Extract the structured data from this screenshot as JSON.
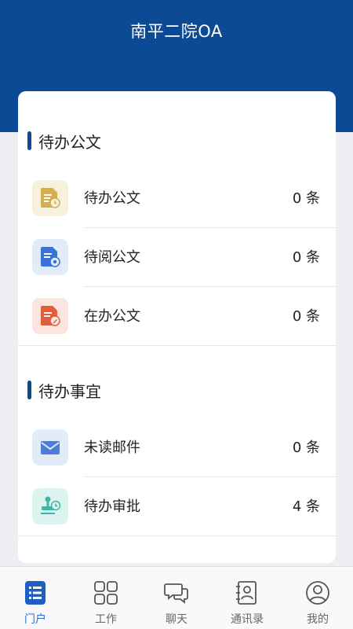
{
  "header": {
    "title": "南平二院OA"
  },
  "sections": [
    {
      "title": "待办公文",
      "items": [
        {
          "label": "待办公文",
          "count": "0 条",
          "icon": "doc-clock-icon",
          "color": "#d3b04d",
          "bg": "#f6f0dc"
        },
        {
          "label": "待阅公文",
          "count": "0 条",
          "icon": "doc-eye-icon",
          "color": "#3a73d6",
          "bg": "#e2ebf8"
        },
        {
          "label": "在办公文",
          "count": "0 条",
          "icon": "doc-edit-icon",
          "color": "#e05e3a",
          "bg": "#fbe6df"
        }
      ]
    },
    {
      "title": "待办事宜",
      "items": [
        {
          "label": "未读邮件",
          "count": "0 条",
          "icon": "mail-icon",
          "color": "#4a7ddc",
          "bg": "#e2ebf8"
        },
        {
          "label": "待办审批",
          "count": "4 条",
          "icon": "stamp-icon",
          "color": "#3db6a6",
          "bg": "#dcf3ef"
        }
      ]
    }
  ],
  "tabbar": {
    "tabs": [
      {
        "label": "门户",
        "icon": "list-icon",
        "active": true
      },
      {
        "label": "工作",
        "icon": "grid-icon",
        "active": false
      },
      {
        "label": "聊天",
        "icon": "chat-icon",
        "active": false
      },
      {
        "label": "通讯录",
        "icon": "contacts-icon",
        "active": false
      },
      {
        "label": "我的",
        "icon": "profile-icon",
        "active": false
      }
    ]
  },
  "colors": {
    "brand": "#0d4a96",
    "active_tab": "#2a6fd8"
  }
}
